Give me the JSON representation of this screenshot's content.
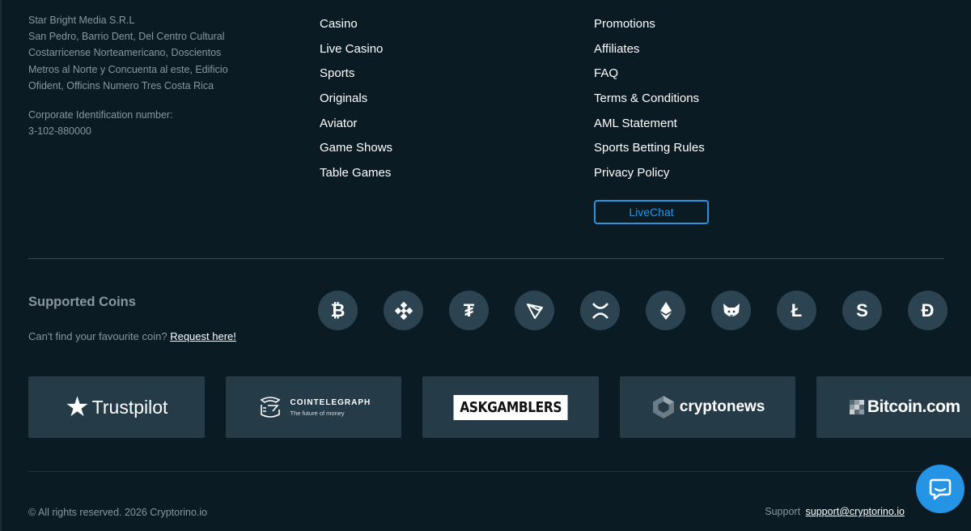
{
  "company": {
    "name": "Star Bright Media S.R.L",
    "address_lines": [
      "San Pedro, Barrio Dent, Del Centro Cultural",
      "Costarricense Norteamericano, Doscientos",
      "Metros al Norte y Concuenta al este, Edificio",
      "Ofident, Officins Numero Tres Costa Rica"
    ],
    "corp_label": "Corporate Identification number:",
    "corp_number": "3-102-880000"
  },
  "links_col1": [
    "Casino",
    "Live Casino",
    "Sports",
    "Originals",
    "Aviator",
    "Game Shows",
    "Table Games"
  ],
  "links_col2": [
    "Promotions",
    "Affiliates",
    "FAQ",
    "Terms & Conditions",
    "AML Statement",
    "Sports Betting Rules",
    "Privacy Policy"
  ],
  "livechat_label": "LiveChat",
  "coins": {
    "title": "Supported Coins",
    "prompt": "Can't find your favourite coin?",
    "request_link": "Request here!",
    "items": [
      {
        "name": "bitcoin-icon",
        "glyph": "₿"
      },
      {
        "name": "bnb-icon",
        "glyph": ""
      },
      {
        "name": "tether-icon",
        "glyph": "₮"
      },
      {
        "name": "tron-icon",
        "glyph": ""
      },
      {
        "name": "xrp-icon",
        "glyph": ""
      },
      {
        "name": "ethereum-icon",
        "glyph": ""
      },
      {
        "name": "shiba-icon",
        "glyph": ""
      },
      {
        "name": "litecoin-icon",
        "glyph": "Ł"
      },
      {
        "name": "stablecoin-s-icon",
        "glyph": "S"
      },
      {
        "name": "dogecoin-icon",
        "glyph": "Ð"
      }
    ],
    "circle_color": "#2c4452"
  },
  "partners": {
    "trustpilot": "Trustpilot",
    "cointelegraph_name": "COINTELEGRAPH",
    "cointelegraph_tagline": "The future of money",
    "askgamblers": "ASKGAMBLERS",
    "cryptonews": "cryptonews",
    "bitcoincom": "Bitcoin.com"
  },
  "footer": {
    "copyright": "© All rights reserved. 2026 Cryptorino.io",
    "support_label": "Support",
    "support_email": "support@cryptorino.io"
  },
  "colors": {
    "background": "#0a1b24",
    "accent": "#2a94df",
    "muted_text": "#8a979e",
    "card": "#253b48"
  }
}
